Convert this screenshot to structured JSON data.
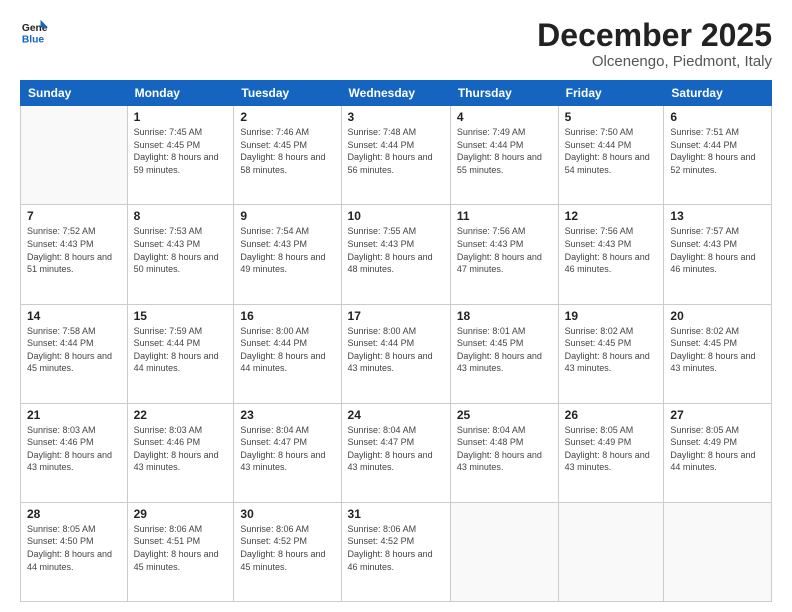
{
  "logo": {
    "line1": "General",
    "line2": "Blue"
  },
  "title": "December 2025",
  "subtitle": "Olcenengo, Piedmont, Italy",
  "weekdays": [
    "Sunday",
    "Monday",
    "Tuesday",
    "Wednesday",
    "Thursday",
    "Friday",
    "Saturday"
  ],
  "weeks": [
    [
      {
        "day": "",
        "sunrise": "",
        "sunset": "",
        "daylight": ""
      },
      {
        "day": "1",
        "sunrise": "7:45 AM",
        "sunset": "4:45 PM",
        "daylight": "8 hours and 59 minutes."
      },
      {
        "day": "2",
        "sunrise": "7:46 AM",
        "sunset": "4:45 PM",
        "daylight": "8 hours and 58 minutes."
      },
      {
        "day": "3",
        "sunrise": "7:48 AM",
        "sunset": "4:44 PM",
        "daylight": "8 hours and 56 minutes."
      },
      {
        "day": "4",
        "sunrise": "7:49 AM",
        "sunset": "4:44 PM",
        "daylight": "8 hours and 55 minutes."
      },
      {
        "day": "5",
        "sunrise": "7:50 AM",
        "sunset": "4:44 PM",
        "daylight": "8 hours and 54 minutes."
      },
      {
        "day": "6",
        "sunrise": "7:51 AM",
        "sunset": "4:44 PM",
        "daylight": "8 hours and 52 minutes."
      }
    ],
    [
      {
        "day": "7",
        "sunrise": "7:52 AM",
        "sunset": "4:43 PM",
        "daylight": "8 hours and 51 minutes."
      },
      {
        "day": "8",
        "sunrise": "7:53 AM",
        "sunset": "4:43 PM",
        "daylight": "8 hours and 50 minutes."
      },
      {
        "day": "9",
        "sunrise": "7:54 AM",
        "sunset": "4:43 PM",
        "daylight": "8 hours and 49 minutes."
      },
      {
        "day": "10",
        "sunrise": "7:55 AM",
        "sunset": "4:43 PM",
        "daylight": "8 hours and 48 minutes."
      },
      {
        "day": "11",
        "sunrise": "7:56 AM",
        "sunset": "4:43 PM",
        "daylight": "8 hours and 47 minutes."
      },
      {
        "day": "12",
        "sunrise": "7:56 AM",
        "sunset": "4:43 PM",
        "daylight": "8 hours and 46 minutes."
      },
      {
        "day": "13",
        "sunrise": "7:57 AM",
        "sunset": "4:43 PM",
        "daylight": "8 hours and 46 minutes."
      }
    ],
    [
      {
        "day": "14",
        "sunrise": "7:58 AM",
        "sunset": "4:44 PM",
        "daylight": "8 hours and 45 minutes."
      },
      {
        "day": "15",
        "sunrise": "7:59 AM",
        "sunset": "4:44 PM",
        "daylight": "8 hours and 44 minutes."
      },
      {
        "day": "16",
        "sunrise": "8:00 AM",
        "sunset": "4:44 PM",
        "daylight": "8 hours and 44 minutes."
      },
      {
        "day": "17",
        "sunrise": "8:00 AM",
        "sunset": "4:44 PM",
        "daylight": "8 hours and 43 minutes."
      },
      {
        "day": "18",
        "sunrise": "8:01 AM",
        "sunset": "4:45 PM",
        "daylight": "8 hours and 43 minutes."
      },
      {
        "day": "19",
        "sunrise": "8:02 AM",
        "sunset": "4:45 PM",
        "daylight": "8 hours and 43 minutes."
      },
      {
        "day": "20",
        "sunrise": "8:02 AM",
        "sunset": "4:45 PM",
        "daylight": "8 hours and 43 minutes."
      }
    ],
    [
      {
        "day": "21",
        "sunrise": "8:03 AM",
        "sunset": "4:46 PM",
        "daylight": "8 hours and 43 minutes."
      },
      {
        "day": "22",
        "sunrise": "8:03 AM",
        "sunset": "4:46 PM",
        "daylight": "8 hours and 43 minutes."
      },
      {
        "day": "23",
        "sunrise": "8:04 AM",
        "sunset": "4:47 PM",
        "daylight": "8 hours and 43 minutes."
      },
      {
        "day": "24",
        "sunrise": "8:04 AM",
        "sunset": "4:47 PM",
        "daylight": "8 hours and 43 minutes."
      },
      {
        "day": "25",
        "sunrise": "8:04 AM",
        "sunset": "4:48 PM",
        "daylight": "8 hours and 43 minutes."
      },
      {
        "day": "26",
        "sunrise": "8:05 AM",
        "sunset": "4:49 PM",
        "daylight": "8 hours and 43 minutes."
      },
      {
        "day": "27",
        "sunrise": "8:05 AM",
        "sunset": "4:49 PM",
        "daylight": "8 hours and 44 minutes."
      }
    ],
    [
      {
        "day": "28",
        "sunrise": "8:05 AM",
        "sunset": "4:50 PM",
        "daylight": "8 hours and 44 minutes."
      },
      {
        "day": "29",
        "sunrise": "8:06 AM",
        "sunset": "4:51 PM",
        "daylight": "8 hours and 45 minutes."
      },
      {
        "day": "30",
        "sunrise": "8:06 AM",
        "sunset": "4:52 PM",
        "daylight": "8 hours and 45 minutes."
      },
      {
        "day": "31",
        "sunrise": "8:06 AM",
        "sunset": "4:52 PM",
        "daylight": "8 hours and 46 minutes."
      },
      {
        "day": "",
        "sunrise": "",
        "sunset": "",
        "daylight": ""
      },
      {
        "day": "",
        "sunrise": "",
        "sunset": "",
        "daylight": ""
      },
      {
        "day": "",
        "sunrise": "",
        "sunset": "",
        "daylight": ""
      }
    ]
  ],
  "labels": {
    "sunrise": "Sunrise:",
    "sunset": "Sunset:",
    "daylight": "Daylight:"
  }
}
